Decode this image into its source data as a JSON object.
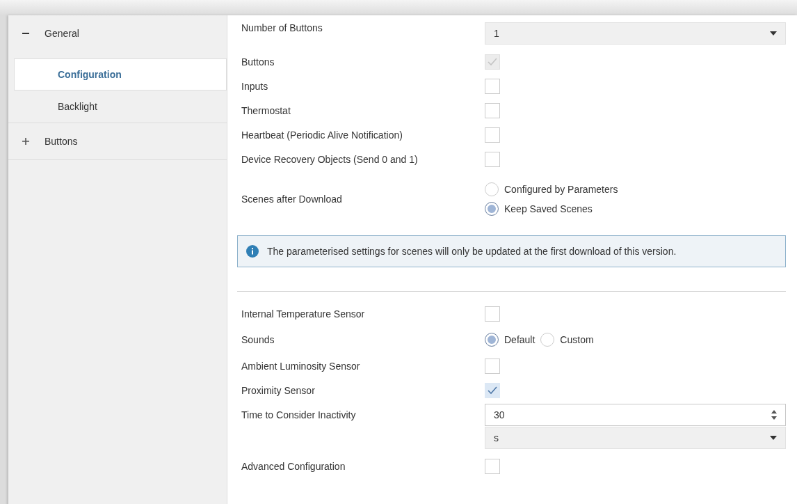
{
  "sidebar": {
    "items": [
      {
        "label": "General",
        "expanded": true,
        "selected": false,
        "children": [
          {
            "label": "Configuration",
            "selected": true
          },
          {
            "label": "Backlight",
            "selected": false
          }
        ]
      },
      {
        "label": "Buttons",
        "expanded": false,
        "selected": false
      }
    ]
  },
  "settings": [
    {
      "kind": "dropdown",
      "label": "Number of Buttons",
      "value": "1"
    },
    {
      "kind": "checkbox",
      "label": "Buttons",
      "checked": true,
      "disabled": true
    },
    {
      "kind": "checkbox",
      "label": "Inputs",
      "checked": false,
      "disabled": false
    },
    {
      "kind": "checkbox",
      "label": "Thermostat",
      "checked": false,
      "disabled": false
    },
    {
      "kind": "checkbox",
      "label": "Heartbeat (Periodic Alive Notification)",
      "checked": false,
      "disabled": false
    },
    {
      "kind": "checkbox",
      "label": "Device Recovery Objects (Send 0 and 1)",
      "checked": false,
      "disabled": false
    },
    {
      "kind": "radio_column",
      "label": "Scenes after Download",
      "options": [
        {
          "label": "Configured by Parameters",
          "selected": false
        },
        {
          "label": "Keep Saved Scenes",
          "selected": true
        }
      ]
    },
    {
      "kind": "info",
      "text": "The parameterised settings for scenes will only be updated at the first download of this version."
    },
    {
      "kind": "divider"
    },
    {
      "kind": "checkbox",
      "label": "Internal Temperature Sensor",
      "checked": false,
      "disabled": false
    },
    {
      "kind": "radio_row",
      "label": "Sounds",
      "options": [
        {
          "label": "Default",
          "selected": true
        },
        {
          "label": "Custom",
          "selected": false
        }
      ]
    },
    {
      "kind": "checkbox",
      "label": "Ambient Luminosity Sensor",
      "checked": false,
      "disabled": false
    },
    {
      "kind": "checkbox",
      "label": "Proximity Sensor",
      "checked": true,
      "disabled": false
    },
    {
      "kind": "spinbox",
      "label": "Time to Consider Inactivity",
      "value": "30"
    },
    {
      "kind": "dropdown",
      "value": "s"
    },
    {
      "kind": "checkbox",
      "label": "Advanced Configuration",
      "checked": false,
      "disabled": false
    }
  ]
}
